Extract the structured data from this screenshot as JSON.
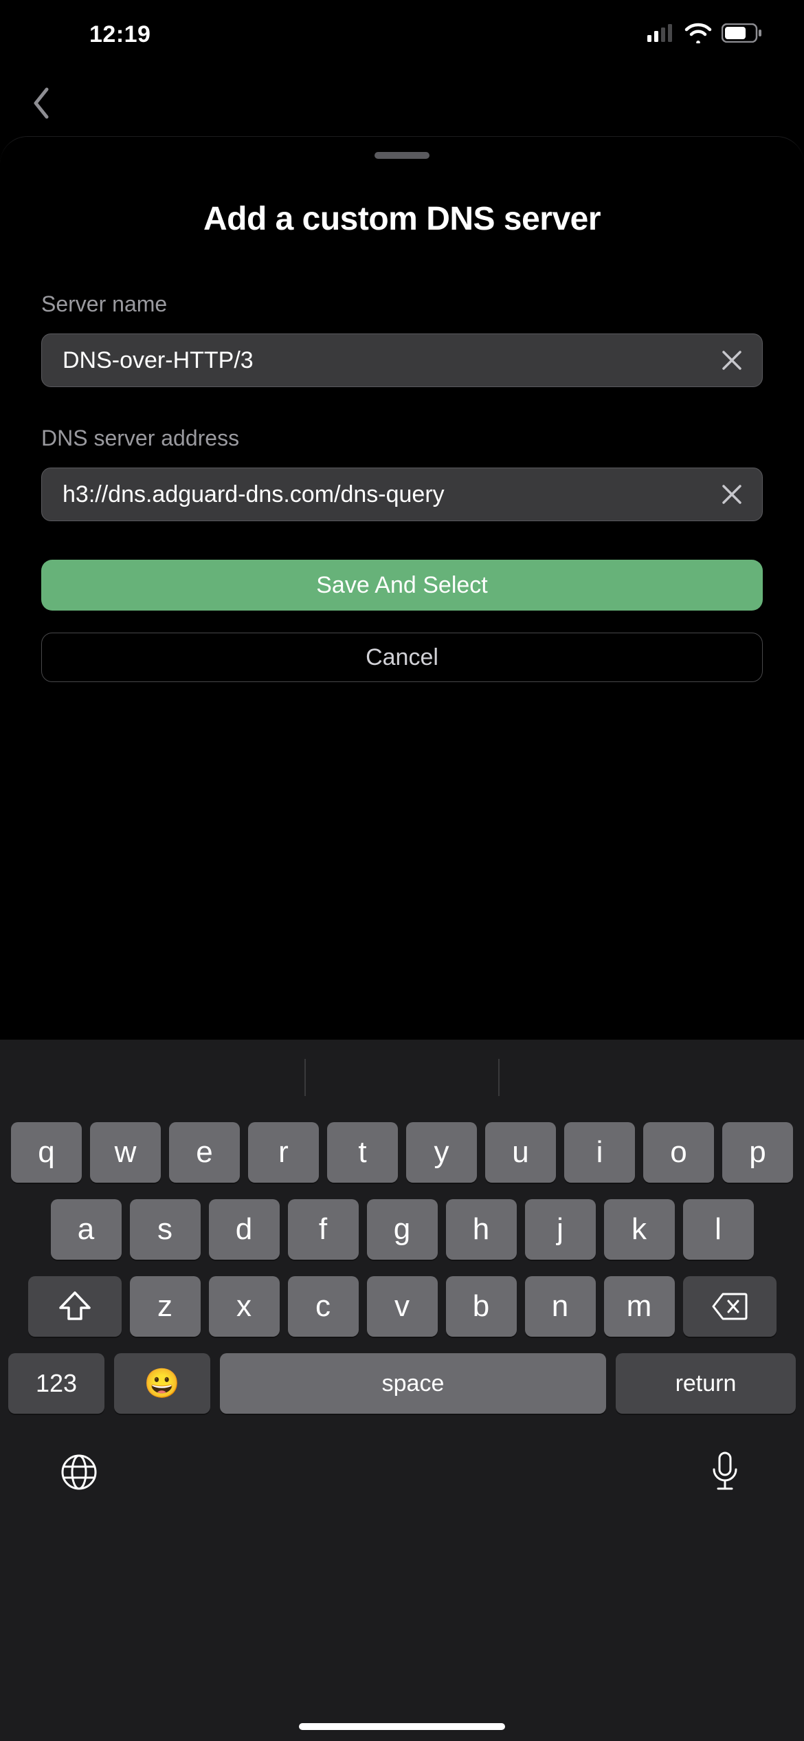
{
  "status": {
    "time": "12:19"
  },
  "sheet": {
    "title": "Add a custom DNS server",
    "server_name_label": "Server name",
    "server_name_value": "DNS-over-HTTP/3",
    "server_address_label": "DNS server address",
    "server_address_value": "h3://dns.adguard-dns.com/dns-query",
    "save_label": "Save And Select",
    "cancel_label": "Cancel"
  },
  "keyboard": {
    "row1": [
      "q",
      "w",
      "e",
      "r",
      "t",
      "y",
      "u",
      "i",
      "o",
      "p"
    ],
    "row2": [
      "a",
      "s",
      "d",
      "f",
      "g",
      "h",
      "j",
      "k",
      "l"
    ],
    "row3": [
      "z",
      "x",
      "c",
      "v",
      "b",
      "n",
      "m"
    ],
    "num_label": "123",
    "space_label": "space",
    "return_label": "return"
  }
}
